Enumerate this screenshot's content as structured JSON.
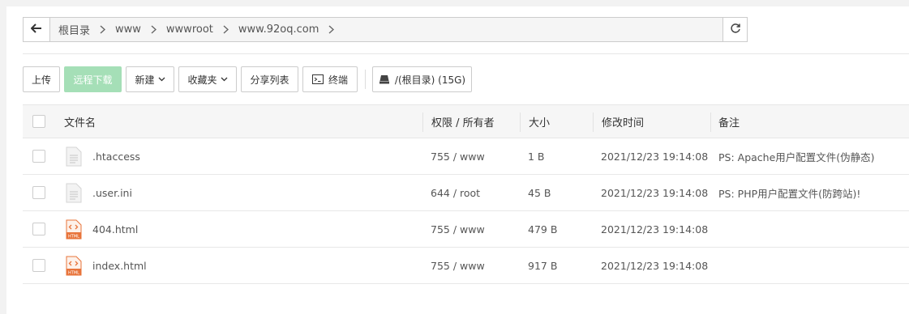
{
  "breadcrumb": {
    "items": [
      "根目录",
      "www",
      "wwwroot",
      "www.92oq.com"
    ]
  },
  "toolbar": {
    "upload": "上传",
    "remote_download": "远程下载",
    "new": "新建",
    "favorites": "收藏夹",
    "share_list": "分享列表",
    "terminal": "终端",
    "disk": "/(根目录) (15G)"
  },
  "table": {
    "headers": {
      "name": "文件名",
      "perm": "权限 / 所有者",
      "size": "大小",
      "mtime": "修改时间",
      "note": "备注"
    },
    "rows": [
      {
        "name": ".htaccess",
        "icon": "file-icon",
        "perm": "755 / www",
        "size": "1 B",
        "mtime": "2021/12/23 19:14:08",
        "note": "PS: Apache用户配置文件(伪静态)"
      },
      {
        "name": ".user.ini",
        "icon": "file-icon",
        "perm": "644 / root",
        "size": "45 B",
        "mtime": "2021/12/23 19:14:08",
        "note": "PS: PHP用户配置文件(防跨站)!"
      },
      {
        "name": "404.html",
        "icon": "html-file-icon",
        "perm": "755 / www",
        "size": "479 B",
        "mtime": "2021/12/23 19:14:08",
        "note": ""
      },
      {
        "name": "index.html",
        "icon": "html-file-icon",
        "perm": "755 / www",
        "size": "917 B",
        "mtime": "2021/12/23 19:14:08",
        "note": ""
      }
    ]
  },
  "colors": {
    "accent_green": "#a5dfb7",
    "html_icon_orange": "#e8743b"
  },
  "icons": {
    "back": "arrow-left-icon",
    "refresh": "refresh-icon",
    "chevron": "chevron-right-icon",
    "caret": "chevron-down-icon",
    "terminal": "terminal-icon",
    "disk": "disk-icon"
  }
}
